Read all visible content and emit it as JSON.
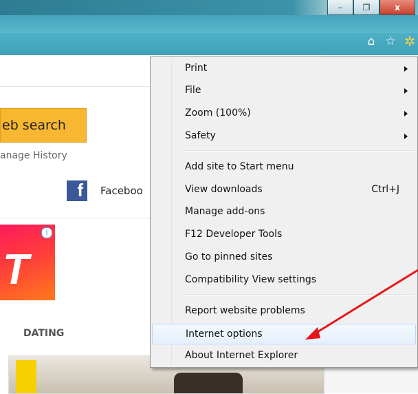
{
  "window": {
    "minimize_glyph": "–",
    "restore_glyph": "❐",
    "close_glyph": "x"
  },
  "toolbar": {
    "home_icon": "⌂",
    "favorites_icon": "☆",
    "tools_icon": "✲"
  },
  "page": {
    "search_button": "eb search",
    "manage_history": "anage History",
    "facebook_letter": "f",
    "facebook_label": "Faceboo",
    "ad_info": "i",
    "ad_logo": "T",
    "dating_label": "DATING"
  },
  "menu": {
    "items": [
      {
        "label": "Print",
        "submenu": true
      },
      {
        "label": "File",
        "submenu": true
      },
      {
        "label": "Zoom (100%)",
        "submenu": true
      },
      {
        "label": "Safety",
        "submenu": true
      },
      {
        "label": "Add site to Start menu"
      },
      {
        "label": "View downloads",
        "shortcut": "Ctrl+J"
      },
      {
        "label": "Manage add-ons"
      },
      {
        "label": "F12 Developer Tools"
      },
      {
        "label": "Go to pinned sites"
      },
      {
        "label": "Compatibility View settings"
      },
      {
        "label": "Report website problems"
      },
      {
        "label": "Internet options",
        "highlighted": true
      },
      {
        "label": "About Internet Explorer"
      }
    ]
  },
  "colors": {
    "annotation_arrow": "#e8151b",
    "search_button": "#f7b731",
    "facebook": "#3b5998"
  }
}
